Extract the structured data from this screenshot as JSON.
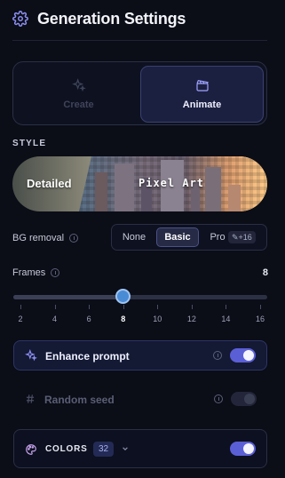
{
  "header": {
    "title": "Generation Settings",
    "icon": "gear-icon"
  },
  "mode": {
    "options": [
      {
        "label": "Create",
        "icon": "sparkle-icon",
        "active": false
      },
      {
        "label": "Animate",
        "icon": "clapperboard-icon",
        "active": true
      }
    ]
  },
  "style": {
    "section_label": "STYLE",
    "options": [
      {
        "label": "Detailed"
      },
      {
        "label": "Pixel Art",
        "selected": true
      }
    ]
  },
  "bg_removal": {
    "label": "BG removal",
    "options": [
      "None",
      "Basic",
      "Pro"
    ],
    "selected": "Basic",
    "pro_badge": "✎+16"
  },
  "frames": {
    "label": "Frames",
    "value": "8",
    "min": 2,
    "max": 16,
    "current": 8,
    "ticks": [
      "2",
      "4",
      "6",
      "8",
      "10",
      "12",
      "14",
      "16"
    ]
  },
  "enhance_prompt": {
    "label": "Enhance prompt",
    "enabled": true
  },
  "random_seed": {
    "label": "Random seed",
    "enabled": false
  },
  "colors": {
    "label": "COLORS",
    "count": "32",
    "enabled": true
  },
  "theme": {
    "accent": "#5b5fd6",
    "background": "#0b0d17",
    "slider_thumb": "#4a8bd6"
  }
}
